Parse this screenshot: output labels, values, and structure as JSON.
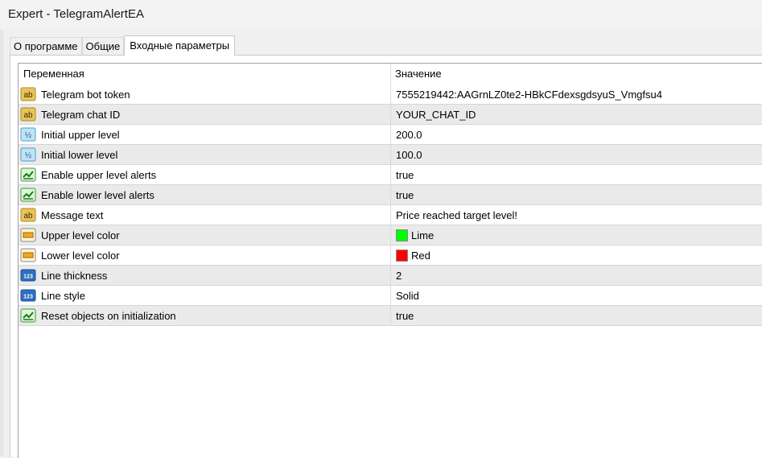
{
  "window": {
    "title": "Expert - TelegramAlertEA"
  },
  "tabs": [
    {
      "label": "О программе",
      "active": false
    },
    {
      "label": "Общие",
      "active": false
    },
    {
      "label": "Входные параметры",
      "active": true
    }
  ],
  "table": {
    "headers": {
      "variable": "Переменная",
      "value": "Значение"
    },
    "rows": [
      {
        "icon": "string-icon",
        "name": "Telegram bot token",
        "value": "7555219442:AAGrnLZ0te2-HBkCFdexsgdsyuS_Vmgfsu4"
      },
      {
        "icon": "string-icon",
        "name": "Telegram chat ID",
        "value": "YOUR_CHAT_ID"
      },
      {
        "icon": "double-icon",
        "name": "Initial upper level",
        "value": "200.0"
      },
      {
        "icon": "double-icon",
        "name": "Initial lower level",
        "value": "100.0"
      },
      {
        "icon": "bool-icon",
        "name": "Enable upper level alerts",
        "value": "true"
      },
      {
        "icon": "bool-icon",
        "name": "Enable lower level alerts",
        "value": "true"
      },
      {
        "icon": "string-icon",
        "name": "Message text",
        "value": "Price reached target level!"
      },
      {
        "icon": "color-icon",
        "name": "Upper level color",
        "value": "Lime",
        "swatch": "#00ff00"
      },
      {
        "icon": "color-icon",
        "name": "Lower level color",
        "value": "Red",
        "swatch": "#ff0000"
      },
      {
        "icon": "int-icon",
        "name": "Line thickness",
        "value": "2"
      },
      {
        "icon": "int-icon",
        "name": "Line style",
        "value": "Solid"
      },
      {
        "icon": "bool-icon",
        "name": "Reset objects on initialization",
        "value": "true"
      }
    ]
  },
  "icon_labels": {
    "string": "ab",
    "double": "½",
    "int": "123"
  }
}
